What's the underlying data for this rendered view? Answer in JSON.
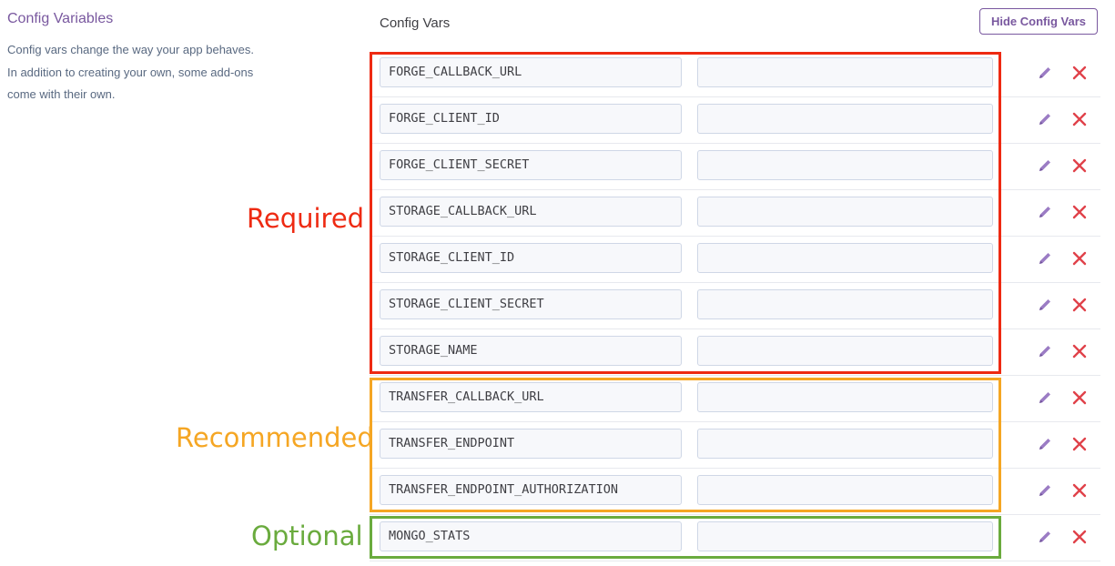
{
  "sidebar": {
    "title": "Config Variables",
    "description": "Config vars change the way your app behaves. In addition to creating your own, some add-ons come with their own."
  },
  "main": {
    "title": "Config Vars",
    "hide_button_label": "Hide Config Vars"
  },
  "config_vars": [
    {
      "key": "FORGE_CALLBACK_URL"
    },
    {
      "key": "FORGE_CLIENT_ID"
    },
    {
      "key": "FORGE_CLIENT_SECRET"
    },
    {
      "key": "STORAGE_CALLBACK_URL"
    },
    {
      "key": "STORAGE_CLIENT_ID"
    },
    {
      "key": "STORAGE_CLIENT_SECRET"
    },
    {
      "key": "STORAGE_NAME"
    },
    {
      "key": "TRANSFER_CALLBACK_URL"
    },
    {
      "key": "TRANSFER_ENDPOINT"
    },
    {
      "key": "TRANSFER_ENDPOINT_AUTHORIZATION"
    },
    {
      "key": "MONGO_STATS"
    }
  ],
  "groups": {
    "required": {
      "label": "Required",
      "color": "#ee2a12"
    },
    "recommended": {
      "label": "Recommended",
      "color": "#f5a623"
    },
    "optional": {
      "label": "Optional",
      "color": "#6aab3e"
    }
  },
  "colors": {
    "accent": "#79589f",
    "edit_icon": "#9b7cc4",
    "delete_icon": "#e0424a"
  },
  "icons": {
    "edit": "pencil-icon",
    "delete": "x-icon"
  }
}
